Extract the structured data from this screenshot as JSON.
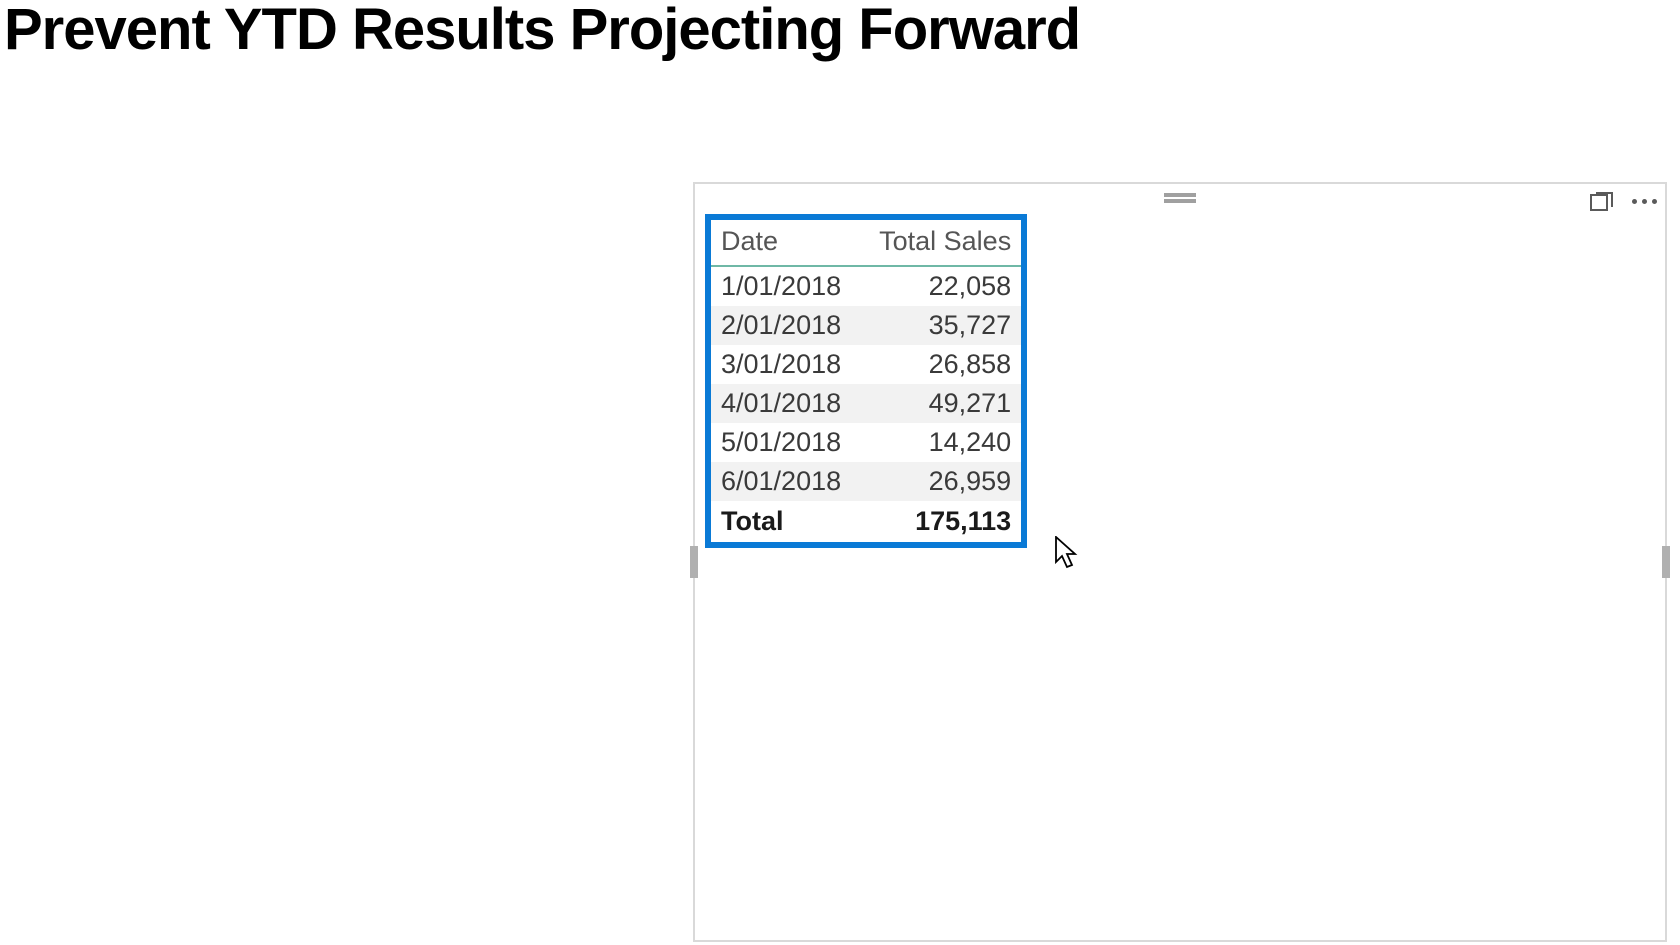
{
  "page": {
    "title": "Prevent YTD Results Projecting Forward"
  },
  "chart_data": {
    "type": "table",
    "columns": [
      "Date",
      "Total Sales"
    ],
    "rows": [
      {
        "date": "1/01/2018",
        "sales": "22,058"
      },
      {
        "date": "2/01/2018",
        "sales": "35,727"
      },
      {
        "date": "3/01/2018",
        "sales": "26,858"
      },
      {
        "date": "4/01/2018",
        "sales": "49,271"
      },
      {
        "date": "5/01/2018",
        "sales": "14,240"
      },
      {
        "date": "6/01/2018",
        "sales": "26,959"
      }
    ],
    "total": {
      "label": "Total",
      "sales": "175,113"
    }
  }
}
